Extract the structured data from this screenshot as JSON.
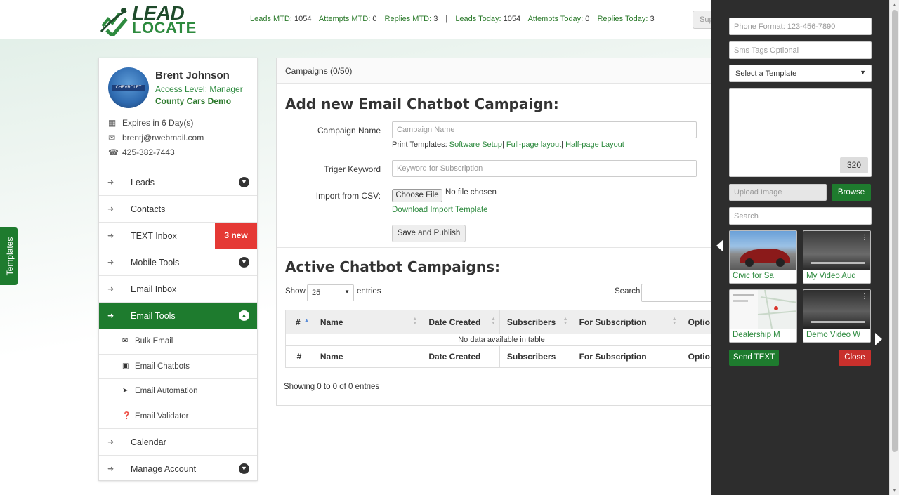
{
  "header": {
    "logo_top": "LEAD",
    "logo_bottom": "LOCATE",
    "stats": [
      {
        "label": "Leads MTD:",
        "value": "1054"
      },
      {
        "label": "Attempts MTD:",
        "value": "0"
      },
      {
        "label": "Replies MTD:",
        "value": "3"
      },
      {
        "label": "Leads Today:",
        "value": "1054"
      },
      {
        "label": "Attempts Today:",
        "value": "0"
      },
      {
        "label": "Replies Today:",
        "value": "3"
      }
    ],
    "separator": "|",
    "sup_button": "Sup"
  },
  "templates_tab": "Templates",
  "profile": {
    "name": "Brent Johnson",
    "access": "Access Level: Manager",
    "company": "County Cars Demo",
    "avatar_sign": "CHEVROLET",
    "expires": "Expires in 6 Day(s)",
    "email": "brentj@rwebmail.com",
    "phone": "425-382-7443"
  },
  "nav": {
    "leads": "Leads",
    "contacts": "Contacts",
    "text_inbox": "TEXT Inbox",
    "text_inbox_badge": "3 new",
    "mobile_tools": "Mobile Tools",
    "email_inbox": "Email Inbox",
    "email_tools": "Email Tools",
    "sub": {
      "bulk_email": "Bulk Email",
      "email_chatbots": "Email Chatbots",
      "email_automation": "Email Automation",
      "email_validator": "Email Validator"
    },
    "calendar": "Calendar",
    "manage_account": "Manage Account"
  },
  "main": {
    "header": "Campaigns (0/50)",
    "add_title": "Add new Email Chatbot Campaign:",
    "campaign_name_label": "Campaign Name",
    "campaign_name_placeholder": "Campaign Name",
    "print_templates_label": "Print Templates:",
    "print_links": [
      "Software Setup",
      "Full-page layout",
      "Half-page Layout"
    ],
    "link_sep": "|",
    "keyword_label": "Triger Keyword",
    "keyword_placeholder": "Keyword for Subscription",
    "import_label": "Import from CSV:",
    "choose_file": "Choose File",
    "no_file": "No file chosen",
    "download_template": "Download Import Template",
    "save_publish": "Save and Publish",
    "active_title": "Active Chatbot Campaigns:",
    "show_label": "Show",
    "show_value": "25",
    "entries_label": "entries",
    "search_label": "Search:",
    "columns": [
      "#",
      "Name",
      "Date Created",
      "Subscribers",
      "For Subscription",
      "Optio"
    ],
    "empty_text": "No data available in table",
    "showing": "Showing 0 to 0 of 0 entries"
  },
  "sms_panel": {
    "phone_placeholder": "Phone Format: 123-456-7890",
    "tags_placeholder": "Sms Tags Optional",
    "select_template": "Select a Template",
    "char_count": "320",
    "upload_placeholder": "Upload Image",
    "browse": "Browse",
    "search_placeholder": "Search",
    "thumbnails": [
      {
        "caption": "Civic for Sa",
        "kind": "car-photo"
      },
      {
        "caption": "My Video Aud",
        "kind": "video"
      },
      {
        "caption": "Dealership M",
        "kind": "map"
      },
      {
        "caption": "Demo Video W",
        "kind": "video"
      }
    ],
    "send": "Send TEXT",
    "close": "Close"
  },
  "colors": {
    "brand_green": "#1e7b2e",
    "link_green": "#2d8a3e",
    "badge_red": "#e53935",
    "close_red": "#c9302c",
    "panel_dark": "#2d2d2d"
  }
}
